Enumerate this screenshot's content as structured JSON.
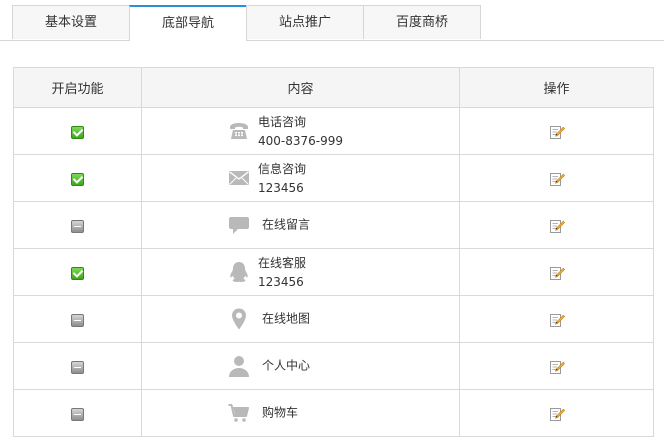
{
  "tabs": [
    {
      "label": "基本设置",
      "active": false
    },
    {
      "label": "底部导航",
      "active": true
    },
    {
      "label": "站点推广",
      "active": false
    },
    {
      "label": "百度商桥",
      "active": false
    }
  ],
  "table": {
    "headers": [
      "开启功能",
      "内容",
      "操作"
    ],
    "rows": [
      {
        "enabled": true,
        "icon": "phone-icon",
        "title": "电话咨询",
        "detail": "400-8376-999"
      },
      {
        "enabled": true,
        "icon": "envelope-icon",
        "title": "信息咨询",
        "detail": "123456"
      },
      {
        "enabled": false,
        "icon": "chat-bubble-icon",
        "title": "在线留言",
        "detail": ""
      },
      {
        "enabled": true,
        "icon": "qq-penguin-icon",
        "title": "在线客服",
        "detail": "123456"
      },
      {
        "enabled": false,
        "icon": "map-pin-icon",
        "title": "在线地图",
        "detail": ""
      },
      {
        "enabled": false,
        "icon": "user-icon",
        "title": "个人中心",
        "detail": ""
      },
      {
        "enabled": false,
        "icon": "cart-icon",
        "title": "购物车",
        "detail": ""
      }
    ]
  },
  "colors": {
    "accent": "#2b8fd6",
    "icon_gray": "#b9b9b9"
  }
}
